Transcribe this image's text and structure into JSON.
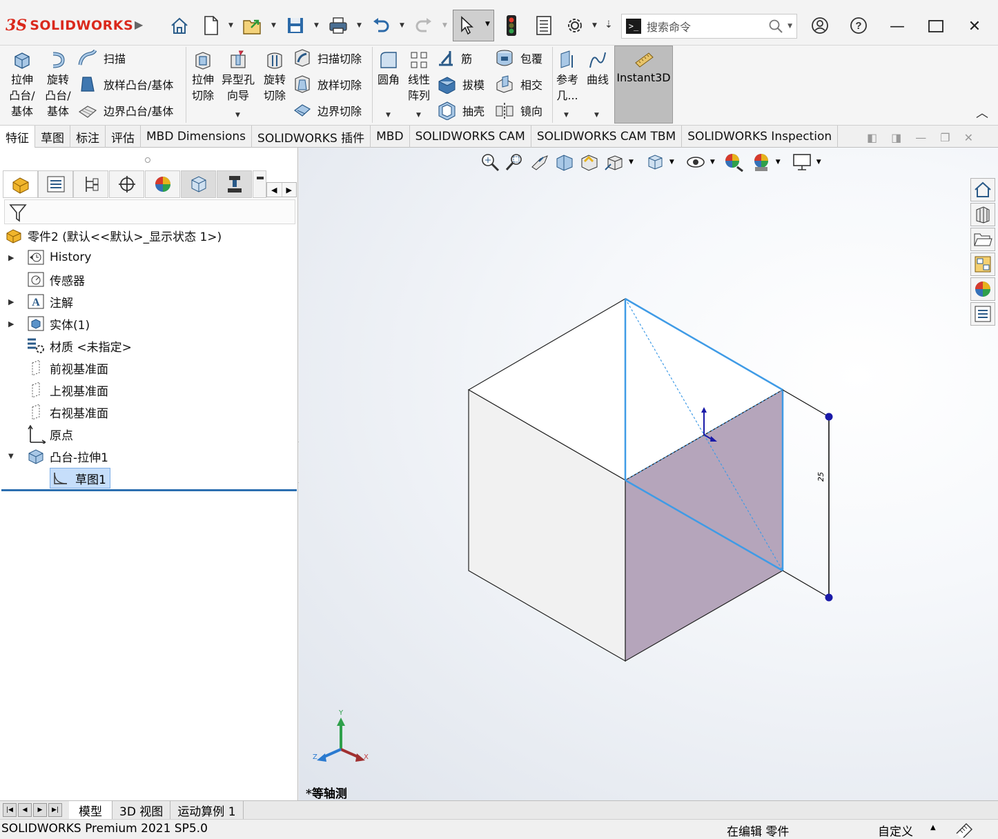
{
  "app": {
    "brand_ds": "3S",
    "brand_name": "SOLIDWORKS"
  },
  "search": {
    "placeholder": "搜索命令",
    "term_glyph": ">_"
  },
  "titlebar_icons": [
    "home-icon",
    "new-document-icon",
    "open-icon",
    "save-icon",
    "print-icon",
    "undo-icon",
    "redo-icon",
    "select-pointer-icon",
    "traffic-light-icon",
    "file-properties-icon",
    "options-gear-icon",
    "user-icon",
    "help-icon"
  ],
  "ribbon": {
    "extrude_boss": "拉伸\n凸台/\n基体",
    "revolve_boss": "旋转\n凸台/\n基体",
    "sweep": "扫描",
    "loft_boss": "放样凸台/基体",
    "boundary_boss": "边界凸台/基体",
    "extrude_cut": "拉伸\n切除",
    "hole_wizard": "异型孔\n向导",
    "revolve_cut": "旋转\n切除",
    "sweep_cut": "扫描切除",
    "loft_cut": "放样切除",
    "boundary_cut": "边界切除",
    "fillet": "圆角",
    "linear_pattern": "线性\n阵列",
    "rib": "筋",
    "draft": "拔模",
    "shell": "抽壳",
    "wrap": "包覆",
    "intersect": "相交",
    "mirror": "镜向",
    "ref_geometry": "参考\n几...",
    "curves": "曲线",
    "instant3d": "Instant3D"
  },
  "tabs": [
    "特征",
    "草图",
    "标注",
    "评估",
    "MBD Dimensions",
    "SOLIDWORKS 插件",
    "MBD",
    "SOLIDWORKS CAM",
    "SOLIDWORKS CAM TBM",
    "SOLIDWORKS Inspection"
  ],
  "tree": {
    "root": "零件2 (默认<<默认>_显示状态 1>)",
    "items": [
      {
        "label": "History",
        "icon": "history-icon",
        "expandable": true
      },
      {
        "label": "传感器",
        "icon": "sensor-icon",
        "expandable": false
      },
      {
        "label": "注解",
        "icon": "annotation-icon",
        "expandable": true
      },
      {
        "label": "实体(1)",
        "icon": "solid-bodies-icon",
        "expandable": true
      },
      {
        "label": "材质 <未指定>",
        "icon": "material-icon",
        "expandable": false
      },
      {
        "label": "前视基准面",
        "icon": "plane-icon",
        "expandable": false
      },
      {
        "label": "上视基准面",
        "icon": "plane-icon",
        "expandable": false
      },
      {
        "label": "右视基准面",
        "icon": "plane-icon",
        "expandable": false
      },
      {
        "label": "原点",
        "icon": "origin-icon",
        "expandable": false
      },
      {
        "label": "凸台-拉伸1",
        "icon": "extrude-feature-icon",
        "expandable": true,
        "expanded": true
      },
      {
        "label": "草图1",
        "icon": "sketch-icon",
        "expandable": false,
        "selected": true
      }
    ]
  },
  "viewport": {
    "view_name": "*等轴测",
    "dimension_label": "25",
    "axis_x": "X",
    "axis_y": "Y",
    "axis_z": "Z"
  },
  "bottom_tabs": [
    "模型",
    "3D 视图",
    "运动算例 1"
  ],
  "status": {
    "product": "SOLIDWORKS Premium 2021 SP5.0",
    "mode": "在编辑 零件",
    "units": "自定义"
  },
  "colors": {
    "accent_blue": "#3f9be6",
    "face_shaded": "#b5a5bb",
    "selection_blue": "#c6defa",
    "brand_red": "#da291c"
  }
}
